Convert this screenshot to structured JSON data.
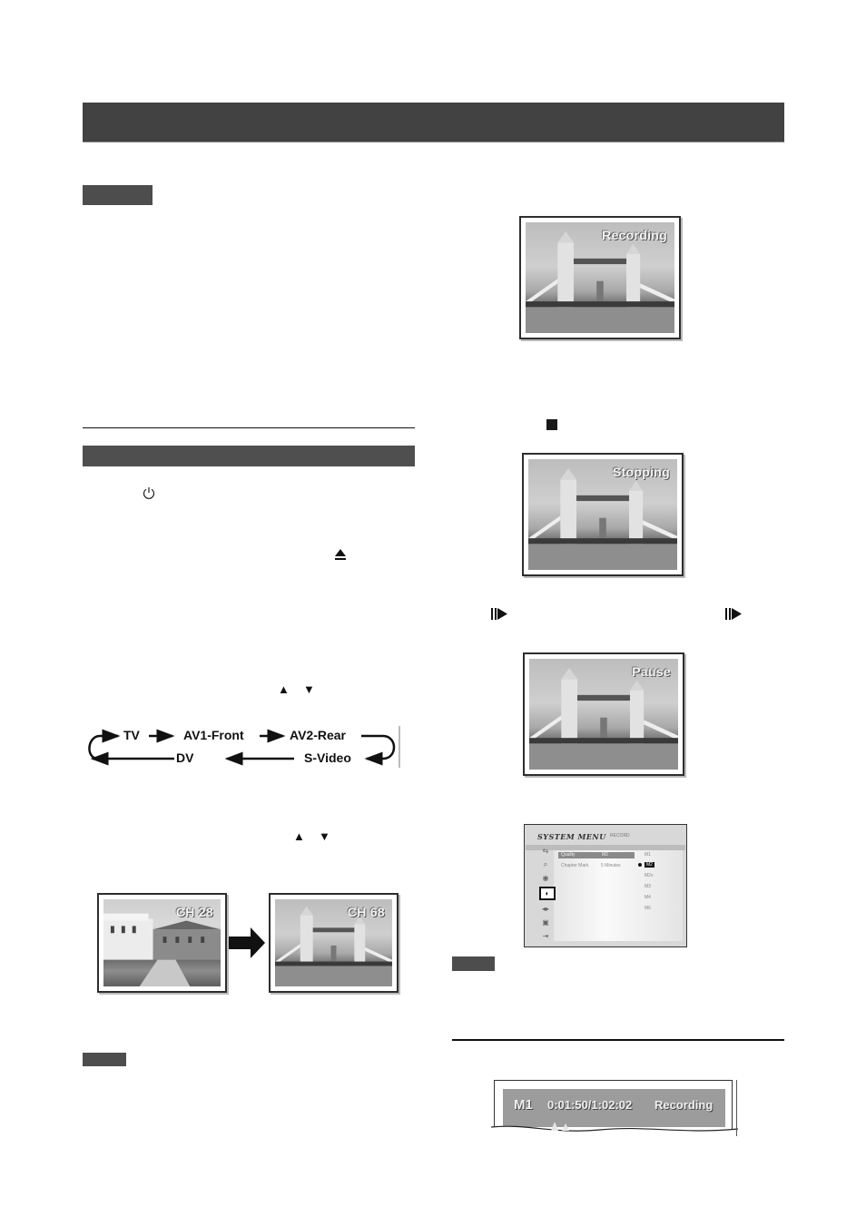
{
  "page": {
    "header_bar": {
      "text": ""
    },
    "note_tags": [
      "",
      "",
      ""
    ]
  },
  "left_column": {
    "icons": {
      "power": "power-icon",
      "eject": "eject-icon",
      "up_down_1": [
        "up-triangle-icon",
        "down-triangle-icon"
      ],
      "up_down_2": [
        "up-triangle-icon",
        "down-triangle-icon"
      ]
    },
    "glyphs": {
      "up": "▲",
      "down": "▼",
      "eject": "⏏"
    },
    "source_cycle": {
      "top_row": [
        "TV",
        "AV1-Front",
        "AV2-Rear"
      ],
      "bottom_row": [
        "DV",
        "S-Video"
      ]
    },
    "channel_change": {
      "from_label": "CH 28",
      "to_label": "CH 68",
      "arrow": "right-arrow-icon"
    }
  },
  "right_column": {
    "screens": [
      {
        "osd": "Recording",
        "name": "recording-screen"
      },
      {
        "osd": "Stopping",
        "name": "stopping-screen"
      },
      {
        "osd": "Pause",
        "name": "pause-screen"
      }
    ],
    "icons": {
      "stop": "stop-icon",
      "step": "pause-step-icon"
    },
    "glyphs": {
      "step": "II▶"
    },
    "system_menu": {
      "title": "SYSTEM MENU",
      "subtitle": "RECORD",
      "rows": [
        {
          "label": "Quality",
          "value": "M2",
          "highlighted": true
        },
        {
          "label": "Chapter Mark",
          "value": "5 Minutes",
          "highlighted": false
        }
      ],
      "options": [
        "M1",
        "M2",
        "M2x",
        "M3",
        "M4",
        "M6"
      ],
      "selected_option": "M2",
      "side_icons": [
        "av-icon",
        "search-icon",
        "disc-icon",
        "record-icon",
        "audio-icon",
        "camera-icon",
        "exit-icon"
      ],
      "active_side_icon": "record-icon"
    },
    "osd_strip": {
      "mode": "M1",
      "time": "0:01:50/1:02:02",
      "status": "Recording"
    }
  }
}
